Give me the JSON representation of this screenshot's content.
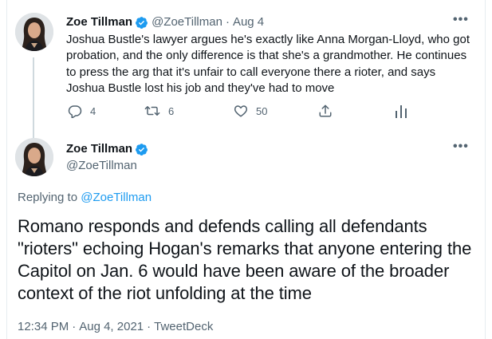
{
  "tweet1": {
    "author_name": "Zoe Tillman",
    "handle": "@ZoeTillman",
    "separator": "·",
    "date": "Aug 4",
    "text": "Joshua Bustle's lawyer argues he's exactly like Anna Morgan-Lloyd, who got probation, and the only difference is that she's a grandmother. He continues to press the arg that it's unfair to call everyone there a rioter, and says Joshua Bustle lost his job and they've had to move",
    "more_glyph": "•••",
    "reply_count": "4",
    "retweet_count": "6",
    "like_count": "50",
    "icons": [
      "reply-icon",
      "retweet-icon",
      "like-icon",
      "share-icon",
      "analytics-icon"
    ]
  },
  "tweet2": {
    "author_name": "Zoe Tillman",
    "handle": "@ZoeTillman",
    "more_glyph": "•••",
    "replying_prefix": "Replying to ",
    "replying_handle": "@ZoeTillman",
    "text": "Romano responds and defends calling all defendants \"rioters\" echoing Hogan's remarks that anyone entering the Capitol on Jan. 6 would have been aware of the broader context of the riot unfolding at the time",
    "time": "12:34 PM",
    "separator": "·",
    "full_date": "Aug 4, 2021",
    "source": "TweetDeck"
  },
  "colors": {
    "accent": "#1d9bf0",
    "text": "#0f1419",
    "secondary": "#536471",
    "divider": "#cfd9de"
  }
}
